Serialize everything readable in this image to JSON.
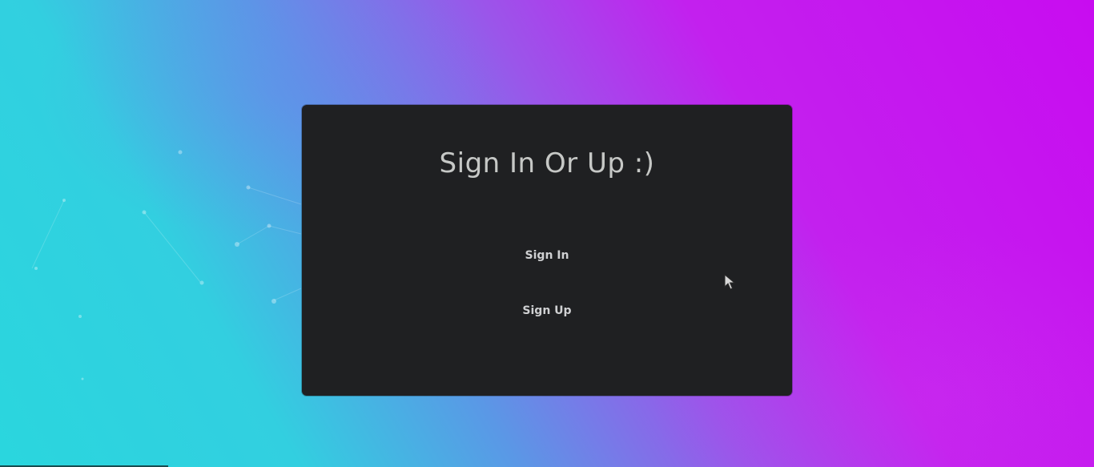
{
  "page": {
    "title": "Sign In Or Up :)",
    "actions": {
      "sign_in": "Sign In",
      "sign_up": "Sign Up"
    }
  },
  "colors": {
    "gradient_start": "#2ad6de",
    "gradient_end": "#c80cf0",
    "card_background": "#1f2022",
    "title_text": "#c6c8c6",
    "link_text": "#cfd0d2"
  },
  "icons": {
    "cursor": "mouse-pointer-icon"
  }
}
